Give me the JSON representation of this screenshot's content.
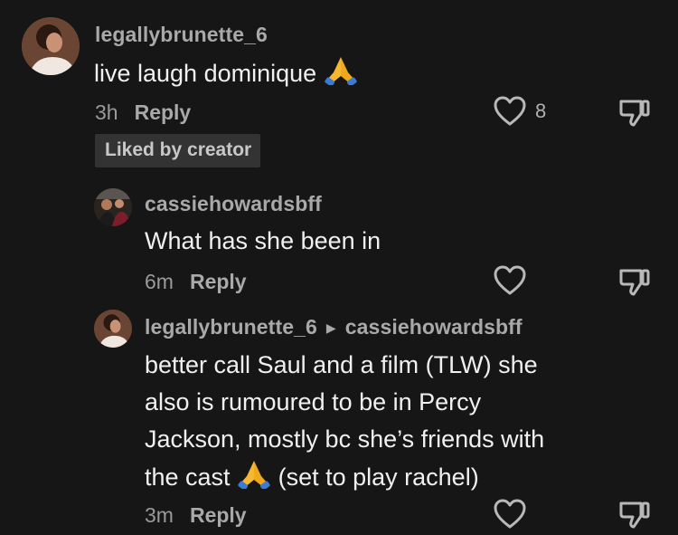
{
  "comments": [
    {
      "username": "legallybrunette_6",
      "text": "live laugh dominique",
      "emoji": "🙏",
      "time": "3h",
      "reply_label": "Reply",
      "like_count": "8",
      "badge": "Liked by creator"
    },
    {
      "username": "cassiehowardsbff",
      "text": "What has she been in",
      "time": "6m",
      "reply_label": "Reply"
    },
    {
      "username": "legallybrunette_6",
      "reply_to": "cassiehowardsbff",
      "lines": [
        "better call Saul and a film (TLW) she",
        "also is rumoured to be in Percy",
        "Jackson, mostly bc she’s friends with",
        "the cast"
      ],
      "emoji": "🙏",
      "line4_tail": "(set to play rachel)",
      "time": "3m",
      "reply_label": "Reply"
    }
  ],
  "icons": {
    "like": "heart-outline-icon",
    "dislike": "thumbs-down-icon",
    "reply_arrow": "triangle-right-icon",
    "emoji": "folded-hands-icon"
  },
  "colors": {
    "background": "#161616",
    "username": "#a9a9a9",
    "text": "#f0f0f0",
    "badge_bg": "#333333",
    "emoji_skin": "#f5b82e",
    "emoji_sleeve": "#3a7bd5"
  }
}
